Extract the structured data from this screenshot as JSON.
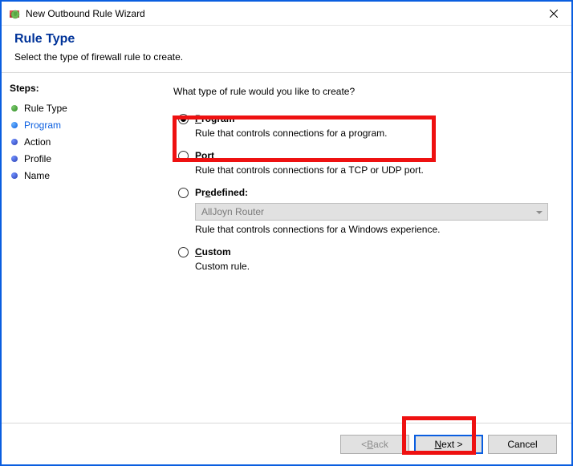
{
  "window": {
    "title": "New Outbound Rule Wizard"
  },
  "header": {
    "title": "Rule Type",
    "subtitle": "Select the type of firewall rule to create."
  },
  "steps": {
    "title": "Steps:",
    "items": [
      {
        "label": "Rule Type",
        "state": "done"
      },
      {
        "label": "Program",
        "state": "current"
      },
      {
        "label": "Action",
        "state": "pending"
      },
      {
        "label": "Profile",
        "state": "pending"
      },
      {
        "label": "Name",
        "state": "pending"
      }
    ]
  },
  "pane": {
    "question": "What type of rule would you like to create?",
    "options": {
      "program": {
        "label_pre": "P",
        "label_rest": "rogram",
        "desc": "Rule that controls connections for a program.",
        "checked": true
      },
      "port": {
        "label_pre": "P",
        "label_rest": "ort",
        "desc": "Rule that controls connections for a TCP or UDP port.",
        "checked": false
      },
      "predefined": {
        "label_pre": "Pr",
        "label_u": "e",
        "label_rest": "defined:",
        "desc": "Rule that controls connections for a Windows experience.",
        "dropdown": "AllJoyn Router",
        "checked": false
      },
      "custom": {
        "label_pre": "C",
        "label_rest": "ustom",
        "desc": "Custom rule.",
        "checked": false
      }
    }
  },
  "footer": {
    "back": {
      "pre": "< ",
      "u": "B",
      "rest": "ack"
    },
    "next": {
      "u": "N",
      "rest": "ext >"
    },
    "cancel": "Cancel"
  }
}
